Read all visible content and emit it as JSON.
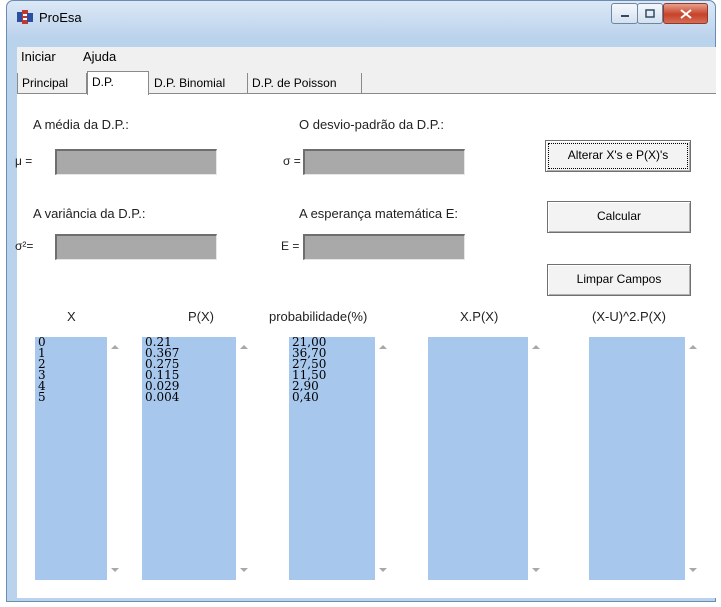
{
  "window": {
    "title": "ProEsa"
  },
  "menu": [
    "Iniciar",
    "Ajuda"
  ],
  "tabs": [
    "Principal",
    "D.P.",
    "D.P. Binomial",
    "D.P. de Poisson"
  ],
  "fields": {
    "media": {
      "label": "A média da D.P.:",
      "prefix": "μ ="
    },
    "desvio": {
      "label": "O desvio-padrão da D.P.:",
      "prefix": "σ ="
    },
    "variancia": {
      "label": "A variância da D.P.:",
      "prefix": "σ²="
    },
    "esperanca": {
      "label": "A esperança matemática E:",
      "prefix": "E ="
    }
  },
  "buttons": {
    "alterar": "Alterar X's e P(X)'s",
    "calcular": "Calcular",
    "limpar": "Limpar Campos"
  },
  "columns": [
    "X",
    "P(X)",
    "probabilidade(%)",
    "X.P(X)",
    "(X-U)^2.P(X)"
  ],
  "lists": {
    "x": [
      "0",
      "1",
      "2",
      "3",
      "4",
      "5"
    ],
    "px": [
      "0.21",
      "0.367",
      "0.275",
      "0.115",
      "0.029",
      "0.004"
    ],
    "prob": [
      "21,00",
      "36,70",
      "27,50",
      "11,50",
      "2,90",
      "0,40"
    ],
    "xpx": [],
    "var": []
  }
}
